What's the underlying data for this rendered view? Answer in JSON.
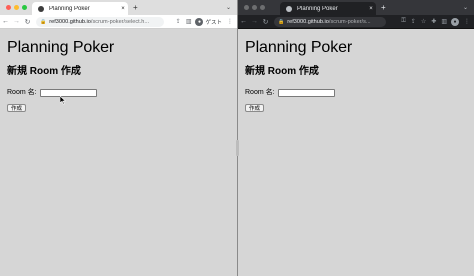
{
  "left_window": {
    "tab_title": "Planning Poker",
    "tab_close": "×",
    "new_tab": "+",
    "tab_search": "⌄",
    "nav_back": "←",
    "nav_forward": "→",
    "nav_reload": "↻",
    "url_host": "ref3000.github.io",
    "url_path": "/scrum-poker/select.h...",
    "guest_label": "ゲスト",
    "page": {
      "title": "Planning Poker",
      "subtitle": "新規 Room 作成",
      "room_label": "Room 名:",
      "room_input_value": "",
      "submit_label": "作成"
    }
  },
  "right_window": {
    "tab_title": "Planning Poker",
    "tab_close": "×",
    "new_tab": "+",
    "tab_search": "⌄",
    "nav_back": "←",
    "nav_forward": "→",
    "nav_reload": "↻",
    "url_host": "ref3000.github.io",
    "url_path": "/scrum-poker/s...",
    "page": {
      "title": "Planning Poker",
      "subtitle": "新規 Room 作成",
      "room_label": "Room 名:",
      "room_input_value": "",
      "submit_label": "作成"
    }
  }
}
